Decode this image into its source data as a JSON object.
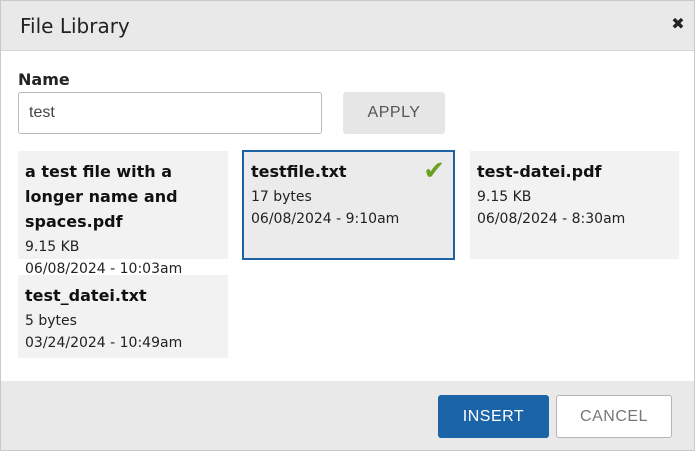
{
  "dialog": {
    "title": "File Library",
    "close_icon": "close-icon",
    "close_glyph": "✖"
  },
  "filter": {
    "label": "Name",
    "value": "test",
    "apply_label": "APPLY"
  },
  "files": [
    {
      "name": "a test file with a longer name and spaces.pdf",
      "size": "9.15 KB",
      "date": "06/08/2024 - 10:03am",
      "selected": false
    },
    {
      "name": "testfile.txt",
      "size": "17 bytes",
      "date": "06/08/2024 - 9:10am",
      "selected": true
    },
    {
      "name": "test-datei.pdf",
      "size": "9.15 KB",
      "date": "06/08/2024 - 8:30am",
      "selected": false
    },
    {
      "name": "test_datei.txt",
      "size": "5 bytes",
      "date": "03/24/2024 - 10:49am",
      "selected": false
    }
  ],
  "selection": {
    "check_icon": "check-icon",
    "check_glyph": "✔"
  },
  "footer": {
    "insert_label": "INSERT",
    "cancel_label": "CANCEL"
  },
  "colors": {
    "header_bg": "#e9e9e9",
    "card_bg": "#f2f2f2",
    "selected_border": "#1e62a6",
    "check": "#6aa121",
    "primary_button": "#1c64a8"
  }
}
